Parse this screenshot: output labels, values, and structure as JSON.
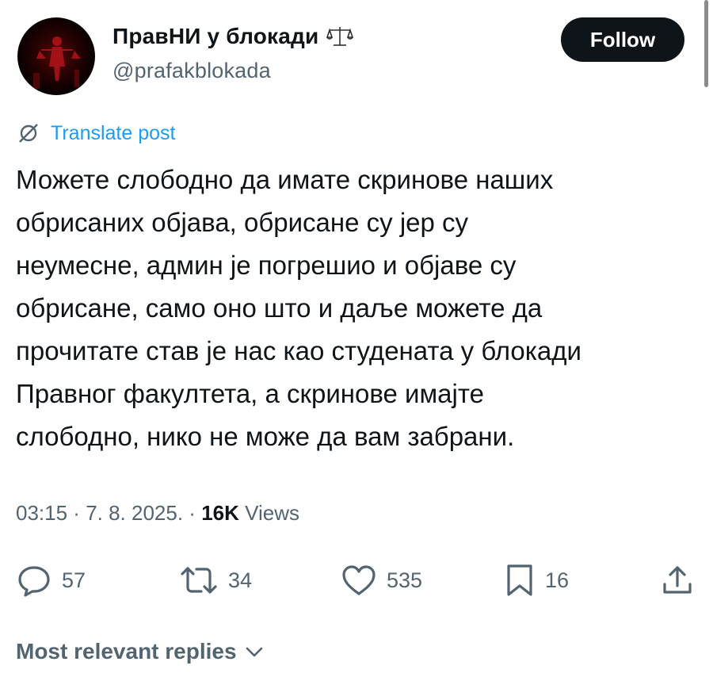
{
  "author": {
    "display_name": "ПравНИ у блокади",
    "name_emoji_icon": "balance-scale-icon",
    "handle": "@prafakblokada",
    "avatar_icon": "lady-justice-avatar"
  },
  "follow_label": "Follow",
  "translate_label": "Translate post",
  "tweet_lines": [
    "Можете слободно да имате скринове наших",
    "обрисаних објава, обрисане су јер су",
    "неумесне, админ је погрешио и објаве су",
    "обрисане, само оно што и даље можете да",
    "прочитате став је нас као студената у блокади",
    "Правног факултета, а скринове имајте",
    "слободно, нико не може да вам забрани."
  ],
  "meta": {
    "time": "03:15",
    "date": "7. 8. 2025.",
    "views_count": "16K",
    "views_label": "Views"
  },
  "actions": {
    "replies": "57",
    "reposts": "34",
    "likes": "535",
    "bookmarks": "16"
  },
  "replies_header": "Most relevant replies",
  "colors": {
    "text": "#0f1419",
    "secondary": "#536471",
    "link": "#1d9bf0",
    "button_bg": "#0f1419"
  }
}
